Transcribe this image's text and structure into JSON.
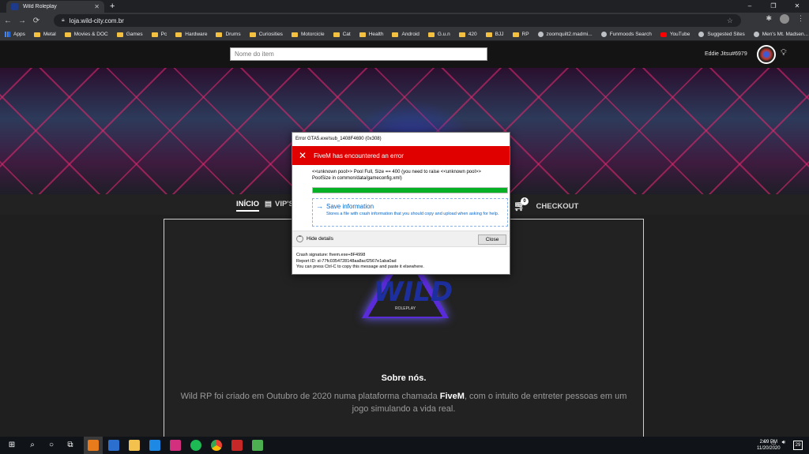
{
  "browser": {
    "tab_title": "Wild Roleplay",
    "new_tab": "+",
    "url": "loja.wild-city.com.br",
    "window_controls": [
      "–",
      "❐",
      "✕"
    ],
    "bookmarks": [
      {
        "label": "Apps",
        "icon": "apps-icon"
      },
      {
        "label": "Metal",
        "icon": "folder-icon"
      },
      {
        "label": "Movies & DOC",
        "icon": "folder-icon"
      },
      {
        "label": "Games",
        "icon": "folder-icon"
      },
      {
        "label": "Pc",
        "icon": "folder-icon"
      },
      {
        "label": "Hardware",
        "icon": "folder-icon"
      },
      {
        "label": "Drums",
        "icon": "folder-icon"
      },
      {
        "label": "Curiosities",
        "icon": "folder-icon"
      },
      {
        "label": "Motorcicle",
        "icon": "folder-icon"
      },
      {
        "label": "Cat",
        "icon": "folder-icon"
      },
      {
        "label": "Health",
        "icon": "folder-icon"
      },
      {
        "label": "Android",
        "icon": "folder-icon"
      },
      {
        "label": "G.u.n",
        "icon": "folder-icon"
      },
      {
        "label": "420",
        "icon": "folder-icon"
      },
      {
        "label": "BJJ",
        "icon": "folder-icon"
      },
      {
        "label": "RP",
        "icon": "folder-icon"
      },
      {
        "label": "zoomquilt2.madmi...",
        "icon": "site-icon"
      },
      {
        "label": "Funmoods Search",
        "icon": "site-icon"
      },
      {
        "label": "YouTube",
        "icon": "youtube-icon"
      },
      {
        "label": "Suggested Sites",
        "icon": "site-icon"
      },
      {
        "label": "Men's Mt. Madsen...",
        "icon": "site-icon"
      }
    ]
  },
  "site": {
    "search_placeholder": "Nome do item",
    "username": "Eddie Jitsu#6979",
    "menu": {
      "inicio": "INÍCIO",
      "vips": "VIP'S",
      "checkout": "CHECKOUT",
      "cart_count": "0"
    },
    "logo_text": "WILD",
    "logo_sub": "ROLEPLAY",
    "about_title": "Sobre nós.",
    "about_text_1": "Wild RP foi criado em Outubro de 2020 numa plataforma chamada ",
    "about_text_bold": "FiveM",
    "about_text_2": ", com o intuito de entreter pessoas em um jogo simulando a vida real."
  },
  "dialog": {
    "window_title": "Error GTA5.exe!sub_1408F4690 (0x308)",
    "header": "FiveM has encountered an error",
    "message": "<<unknown pool>> Pool Full, Size == 400 (you need to raise <<unknown pool>> PoolSize in common/data/gameconfig.xml)",
    "progress": 1.0,
    "save_title": "Save information",
    "save_desc": "Stores a file with crash information that you should copy and upload when asking for help.",
    "hide_details": "Hide details",
    "close": "Close",
    "crash_signature": "Crash signature: fivem.exe+8F4998",
    "report_id": "Report ID: sl-77fc0354728148aa8acf2567e1aba0ad",
    "copy_hint": "You can press Ctrl-C to copy this message and paste it elsewhere."
  },
  "taskbar": {
    "time": "2:09 PM",
    "date": "11/20/2020",
    "notifications": "29"
  },
  "colors": {
    "error_red": "#e10000",
    "progress_green": "#06b025",
    "link_blue": "#0066cc"
  }
}
